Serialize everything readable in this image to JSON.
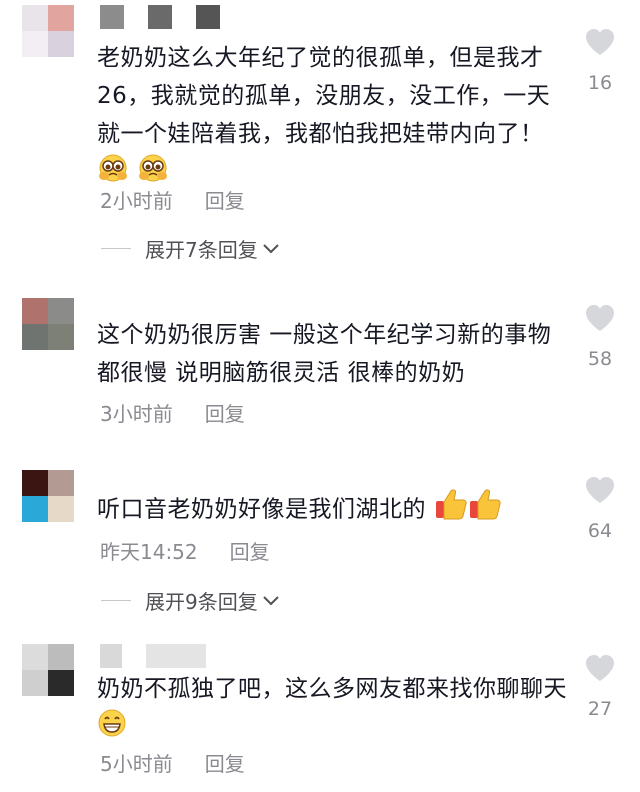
{
  "comments": [
    {
      "text": "老奶奶这么大年纪了觉的很孤单，但是我才26，我就觉的孤单，没朋友，没工作，一天就一个娃陪着我，我都怕我把娃带内向了！",
      "emoji": [
        "pleading-face",
        "pleading-face"
      ],
      "time": "2小时前",
      "reply": "回复",
      "likes": "16",
      "expand": "展开7条回复",
      "avatar_colors": [
        "#e8e4ea",
        "#e2a49f",
        "#f2eef4",
        "#d9d1de"
      ]
    },
    {
      "text": "这个奶奶很厉害 一般这个年纪学习新的事物都很慢 说明脑筋很灵活 很棒的奶奶",
      "time": "3小时前",
      "reply": "回复",
      "likes": "58",
      "avatar_colors": [
        "#b0726d",
        "#8b8b89",
        "#6f7471",
        "#7c8077"
      ]
    },
    {
      "text": "听口音老奶奶好像是我们湖北的",
      "emoji": [
        "thumbs-up",
        "thumbs-up"
      ],
      "time": "昨天14:52",
      "reply": "回复",
      "likes": "64",
      "expand": "展开9条回复",
      "avatar_colors": [
        "#3a1512",
        "#b39a93",
        "#2aa9d8",
        "#e7d9c7"
      ]
    },
    {
      "text": "奶奶不孤独了吧，这么多网友都来找你聊聊天",
      "emoji": [
        "grinning-face"
      ],
      "time": "5小时前",
      "reply": "回复",
      "likes": "27",
      "avatar_colors": [
        "#dcdcdc",
        "#bcbcbc",
        "#cfcfcf",
        "#2a2a2a"
      ]
    }
  ]
}
